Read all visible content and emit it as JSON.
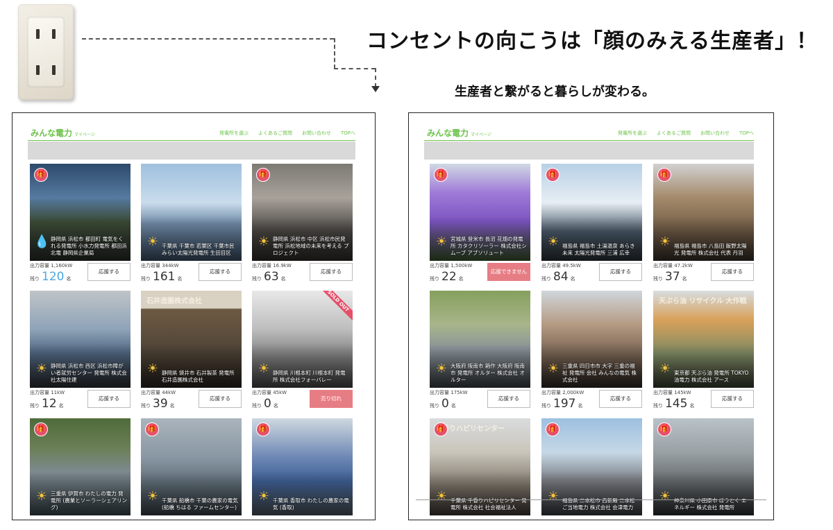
{
  "headline": "コンセントの向こうは「顔のみえる生産者」！",
  "subline": "生産者と繋がると暮らしが変わる。",
  "site": {
    "logo": "みんな電力",
    "logo_sub": "マイページ",
    "nav": [
      "発電所を選ぶ",
      "よくあるご質問",
      "お問い合わせ",
      "TOPへ"
    ]
  },
  "left_cards": [
    {
      "caption": "静岡県 浜松市 都田町 電気をくれる発電所 小水力発電所 都田浜北電 静岡県企業局",
      "output": "出力容量 1,160kW",
      "count_label": "残り",
      "count": "120",
      "unit": "名",
      "button": "応援する",
      "icon": "water",
      "gift": true
    },
    {
      "caption": "千葉県 千葉市 若葉区 千葉市民みらい太陽光発電所 生田目区",
      "output": "出力容量 344kW",
      "count_label": "残り",
      "count": "161",
      "unit": "名",
      "button": "応援する",
      "icon": "sun",
      "gift": false
    },
    {
      "caption": "静岡県 浜松市 中区 浜松市民発電所 浜松地域の未来を考える プロジェクト",
      "output": "出力容量 16.9kW",
      "count_label": "残り",
      "count": "63",
      "unit": "名",
      "button": "応援する",
      "icon": "sun",
      "gift": true
    },
    {
      "caption": "静岡県 浜松市 西区 浜松市障がい者就労センター 発電所 株式会社太陽住建",
      "output": "出力容量 11kW",
      "count_label": "残り",
      "count": "12",
      "unit": "名",
      "button": "応援する",
      "icon": "sun",
      "gift": false
    },
    {
      "caption": "静岡県 袋井市 石井製茶 発電所 石井造園株式会社",
      "output": "出力容量 44kW",
      "count_label": "残り",
      "count": "39",
      "unit": "名",
      "button": "応援する",
      "icon": "sun",
      "gift": false,
      "sign": "石井造園株式会社"
    },
    {
      "caption": "静岡県 川根本町 川根本町 発電所 株式会社フォーバレー",
      "output": "出力容量 45kW",
      "count_label": "残り",
      "count": "0",
      "unit": "名",
      "button": "売り切れ",
      "icon": "sun",
      "gift": false,
      "sold_out": "SOLD OUT",
      "pink": true
    },
    {
      "caption": "三重県 伊賀市 わたしの電力 発電所 (農業とソーラーシェアリング)",
      "output": "",
      "count_label": "",
      "count": "",
      "unit": "",
      "button": "",
      "icon": "sun",
      "gift": true
    },
    {
      "caption": "千葉県 船橋市 千葉の農家の電気 (船橋 ちはる ファームセンター)",
      "output": "",
      "count_label": "",
      "count": "",
      "unit": "",
      "button": "",
      "icon": "sun",
      "gift": true
    },
    {
      "caption": "千葉県 香取市 わたしの農家の電気 (香取)",
      "output": "",
      "count_label": "",
      "count": "",
      "unit": "",
      "button": "",
      "icon": "sun",
      "gift": true
    }
  ],
  "right_cards": [
    {
      "caption": "宮城県 登米市 長沼 花畑の発電所 カタクリソーラー 株式会社シムーブ アブソリュート",
      "output": "出力容量 1,500kW",
      "count_label": "残り",
      "count": "22",
      "unit": "名",
      "button": "応援できません",
      "icon": "sun",
      "gift": true,
      "pink": true
    },
    {
      "caption": "福島県 福島市 土湯温泉 あらき未来 太陽光発電所 三浦 広幸",
      "output": "出力容量 49.5kW",
      "count_label": "残り",
      "count": "84",
      "unit": "名",
      "button": "応援する",
      "icon": "sun",
      "gift": true
    },
    {
      "caption": "福島県 福島市 八島田 飯野太陽光 発電所 株式会社 代表 丹羽",
      "output": "出力容量 47.2kW",
      "count_label": "残り",
      "count": "37",
      "unit": "名",
      "button": "応援する",
      "icon": "sun",
      "gift": true
    },
    {
      "caption": "大阪府 阪南市 箱作 大阪府 阪南市 発電所 オルター 株式会社 オルター",
      "output": "出力容量 175kW",
      "count_label": "残り",
      "count": "0",
      "unit": "名",
      "button": "応援する",
      "icon": "sun",
      "gift": false
    },
    {
      "caption": "三重県 四日市市 大字 三重の福祉 発電所 会社 みんなの電気 株式会社",
      "output": "出力容量 2,000kW",
      "count_label": "残り",
      "count": "197",
      "unit": "名",
      "button": "応援する",
      "icon": "sun",
      "gift": false
    },
    {
      "caption": "東京都 天ぷら油 発電所 TOKYO 油電力 株式会社 アース",
      "output": "出力容量 145kW",
      "count_label": "残り",
      "count": "145",
      "unit": "名",
      "button": "応援する",
      "icon": "sun",
      "gift": false,
      "sign": "天ぷら油 リサイクル 大作戦"
    },
    {
      "caption": "千葉県 千香りハピリセンター 発電所 株式会社 社会福祉法人",
      "output": "",
      "count_label": "",
      "count": "",
      "unit": "",
      "button": "",
      "icon": "sun",
      "gift": true,
      "sign": "千香りハピリセンター"
    },
    {
      "caption": "福島県 二本松市 西新殿 二本松 ご当地電力 株式会社 会津電力",
      "output": "",
      "count_label": "",
      "count": "",
      "unit": "",
      "button": "",
      "icon": "sun",
      "gift": true
    },
    {
      "caption": "神奈川県 小田原市 ほうとく エネルギー 株式会社 発電所",
      "output": "",
      "count_label": "",
      "count": "",
      "unit": "",
      "button": "",
      "icon": "sun",
      "gift": true
    }
  ]
}
